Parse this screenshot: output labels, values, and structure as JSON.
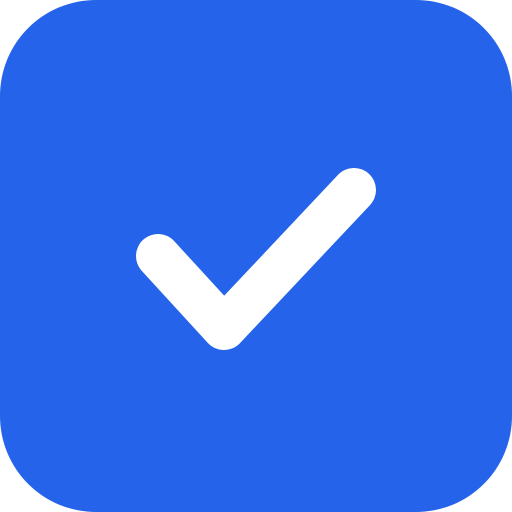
{
  "checkbox": {
    "state": "checked",
    "icon": "check-icon",
    "colors": {
      "fill": "#2563EB",
      "check": "#FFFFFF"
    }
  }
}
